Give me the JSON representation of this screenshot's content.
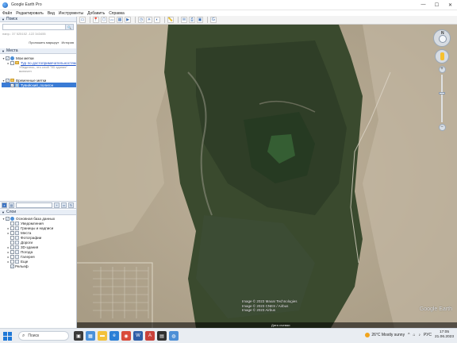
{
  "window": {
    "title": "Google Earth Pro",
    "controls": {
      "minimize": "—",
      "maximize": "☐",
      "close": "✕"
    }
  },
  "menu": [
    "Файл",
    "Редактировать",
    "Вид",
    "Инструменты",
    "Добавить",
    "Справка"
  ],
  "search": {
    "header": "Поиск",
    "hint": "напр.: 37 525152 -122 343455",
    "route_link": "Проложить маршрут",
    "history_link": "История"
  },
  "places": {
    "header": "Места",
    "my_places": "Мои метки",
    "tour": "Тур по достопримечательностям",
    "tour_note": "Убедитесь, что слой \"3D здания\" включен",
    "temp_places": "Временные метки",
    "selected_item": "Тувийский_полигон"
  },
  "layers": {
    "header": "Слои",
    "items": [
      "Основная база данных",
      "Уведомления",
      "Границы и надписи",
      "Места",
      "Фотографии",
      "Дороги",
      "3D-здания",
      "Погода",
      "Галерея",
      "Еще",
      "Рельеф"
    ]
  },
  "map": {
    "attribution": [
      "Image © 2023 Maxar Technologies",
      "Image © 2023 CNES / Airbus",
      "Image © 2023 Airbus"
    ],
    "brand": "Google Earth",
    "status_date": "Дата съемки",
    "compass_n": "N"
  },
  "taskbar": {
    "search_placeholder": "Поиск",
    "weather": "26°C  Mostly sunny",
    "lang": "РУС",
    "time": "17:05",
    "date": "21.06.2023"
  },
  "colors": {
    "selection": "#3a7bd5",
    "link": "#2052c8",
    "start": "#1e78d7"
  }
}
